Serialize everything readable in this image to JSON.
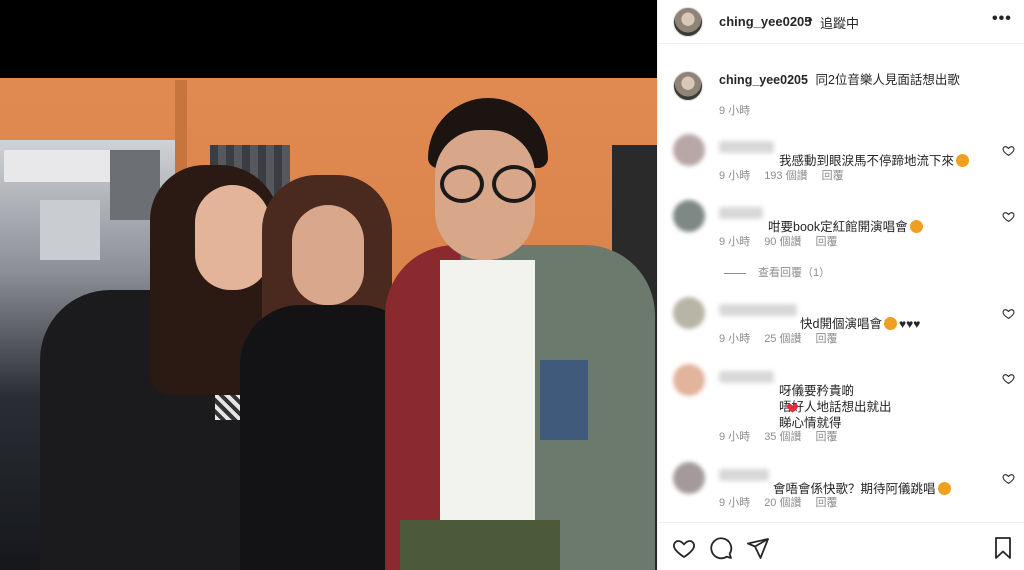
{
  "photo": {
    "alt_people_count": 3
  },
  "post": {
    "header": {
      "username": "ching_yee0205",
      "separator": "•",
      "follow_status": "追蹤中",
      "more": "•••"
    },
    "caption": {
      "username": "ching_yee0205",
      "text": "同2位音樂人見面話想出歌",
      "time": "9 小時"
    },
    "comments": [
      {
        "text": "我感動到眼淚馬不停蹄地流下來",
        "emoji": "heart-eyes",
        "time": "9 小時",
        "likes": "193 個讚",
        "reply": "回覆"
      },
      {
        "text": "咁要book定紅館開演唱會",
        "emoji": "heart-eyes",
        "time": "9 小時",
        "likes": "90 個讚",
        "reply": "回覆"
      },
      {
        "text": "快d開個演唱會",
        "emoji": "sad-face-and-black-hearts",
        "time": "9 小時",
        "likes": "25 個讚",
        "reply": "回覆"
      },
      {
        "text": "呀儀要矜貴啲\n唔好人地話想出就出\n睇心情就得",
        "emoji": "red-heart",
        "time": "9 小時",
        "likes": "35 個讚",
        "reply": "回覆"
      },
      {
        "text": "會唔會係快歌？期待阿儀跳唱",
        "emoji": "heart-eyes",
        "time": "9 小時",
        "likes": "20 個讚",
        "reply": "回覆"
      }
    ],
    "view_replies": "查看回覆（1）",
    "actions": {
      "like": "heart-icon",
      "comment": "comment-icon",
      "share": "share-icon",
      "save": "bookmark-icon"
    }
  },
  "colors": {
    "text": "#262626",
    "muted": "#8e8e8e",
    "divider": "#efefef",
    "emoji_yellow": "#f0a020",
    "heart_red": "#ed2a3c"
  }
}
